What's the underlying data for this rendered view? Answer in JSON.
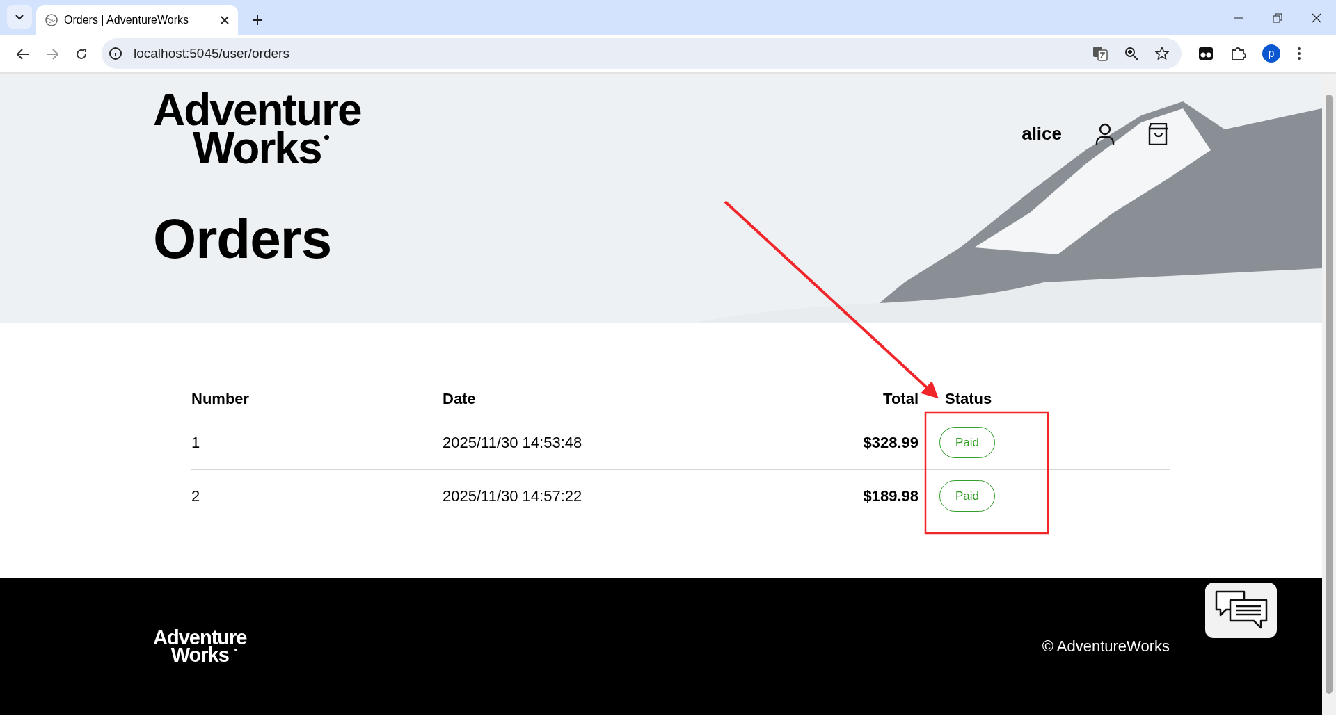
{
  "browser": {
    "tab_title": "Orders | AdventureWorks",
    "url": "localhost:5045/user/orders",
    "profile_initial": "p"
  },
  "header": {
    "logo": [
      "Adventure",
      "Works"
    ],
    "username": "alice"
  },
  "page_title": "Orders",
  "table": {
    "columns": [
      "Number",
      "Date",
      "Total",
      "Status"
    ],
    "rows": [
      {
        "number": "1",
        "date": "2025/11/30 14:53:48",
        "total": "$328.99",
        "status": "Paid"
      },
      {
        "number": "2",
        "date": "2025/11/30 14:57:22",
        "total": "$189.98",
        "status": "Paid"
      }
    ]
  },
  "footer": {
    "logo": [
      "Adventure",
      "Works"
    ],
    "copyright": "© AdventureWorks"
  }
}
